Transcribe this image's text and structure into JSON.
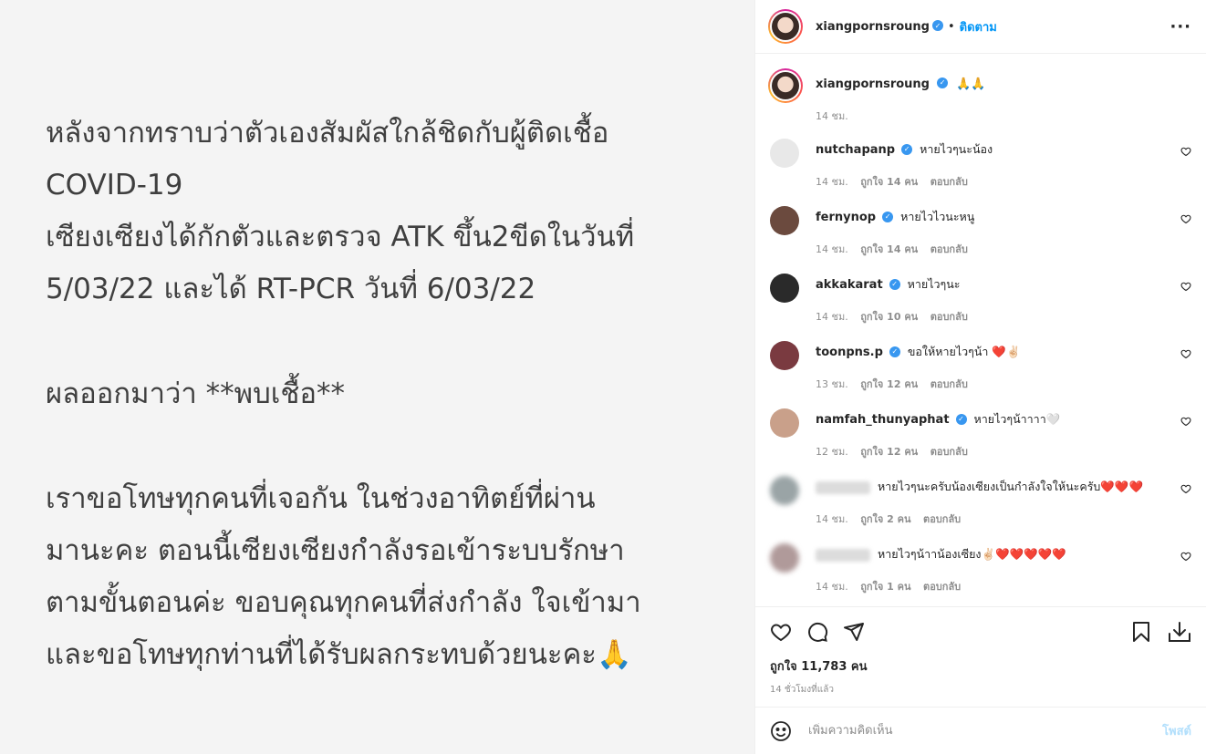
{
  "post": {
    "lines": [
      "หลังจากทราบว่าตัวเองสัมผัสใกล้ชิดกับผู้ติดเชื้อ",
      "COVID-19",
      "เซียงเซียงได้กักตัวและตรวจ ATK ขึ้น2ขีดในวันที่",
      "5/03/22 และได้ RT-PCR วันที่ 6/03/22",
      "ผลออกมาว่า **พบเชื้อ**",
      "เราขอโทษทุกคนที่เจอกัน ในช่วงอาทิตย์ที่ผ่าน",
      "มานะคะ ตอนนี้เซียงเซียงกำลังรอเข้าระบบรักษา",
      "ตามขั้นตอนค่ะ ขอบคุณทุกคนที่ส่งกำลัง ใจเข้ามา",
      "และขอโทษทุกท่านที่ได้รับผลกระทบด้วยนะคะ🙏"
    ]
  },
  "header": {
    "username": "xiangpornsroung",
    "separator": "•",
    "follow_label": "ติดตาม",
    "more": "···"
  },
  "caption": {
    "username": "xiangpornsroung",
    "text": "🙏🙏",
    "time": "14 ชม."
  },
  "comments": [
    {
      "username": "nutchapanp",
      "verified": true,
      "text": "หายไวๆนะน้อง",
      "time": "14 ชม.",
      "likes": "ถูกใจ 14 คน",
      "reply": "ตอบกลับ",
      "avatar_color": "#e8e8e8"
    },
    {
      "username": "fernynop",
      "verified": true,
      "text": "หายไวไวนะหนู",
      "time": "14 ชม.",
      "likes": "ถูกใจ 14 คน",
      "reply": "ตอบกลับ",
      "avatar_color": "#6b4a3e"
    },
    {
      "username": "akkakarat",
      "verified": true,
      "text": "หายไวๆนะ",
      "time": "14 ชม.",
      "likes": "ถูกใจ 10 คน",
      "reply": "ตอบกลับ",
      "avatar_color": "#2a2a2a"
    },
    {
      "username": "toonpns.p",
      "verified": true,
      "text": "ขอให้หายไวๆน้า ❤️✌🏻",
      "time": "13 ชม.",
      "likes": "ถูกใจ 12 คน",
      "reply": "ตอบกลับ",
      "avatar_color": "#7a3a40"
    },
    {
      "username": "namfah_thunyaphat",
      "verified": true,
      "text": "หายไวๆน้าาาา🤍",
      "time": "12 ชม.",
      "likes": "ถูกใจ 12 คน",
      "reply": "ตอบกลับ",
      "avatar_color": "#c9a08a"
    },
    {
      "username": "",
      "verified": false,
      "text": "หายไวๆนะครับน้องเซียงเป็นกำลังใจให้นะครับ❤️❤️❤️",
      "time": "14 ชม.",
      "likes": "ถูกใจ 2 คน",
      "reply": "ตอบกลับ",
      "avatar_color": "#9aa4a6"
    },
    {
      "username": "",
      "verified": false,
      "text": "หายไวๆน้าาน้องเซียง✌🏻❤️❤️❤️❤️❤️",
      "time": "14 ชม.",
      "likes": "ถูกใจ 1 คน",
      "reply": "ตอบกลับ",
      "avatar_color": "#b09a9a"
    }
  ],
  "actions": {
    "likes": "ถูกใจ 11,783 คน",
    "time": "14 ชั่วโมงที่แล้ว"
  },
  "add_comment": {
    "placeholder": "เพิ่มความคิดเห็น",
    "post_label": "โพสต์"
  },
  "colors": {
    "accent": "#0095f6",
    "verified": "#3897f0",
    "muted": "#8e8e8e"
  }
}
